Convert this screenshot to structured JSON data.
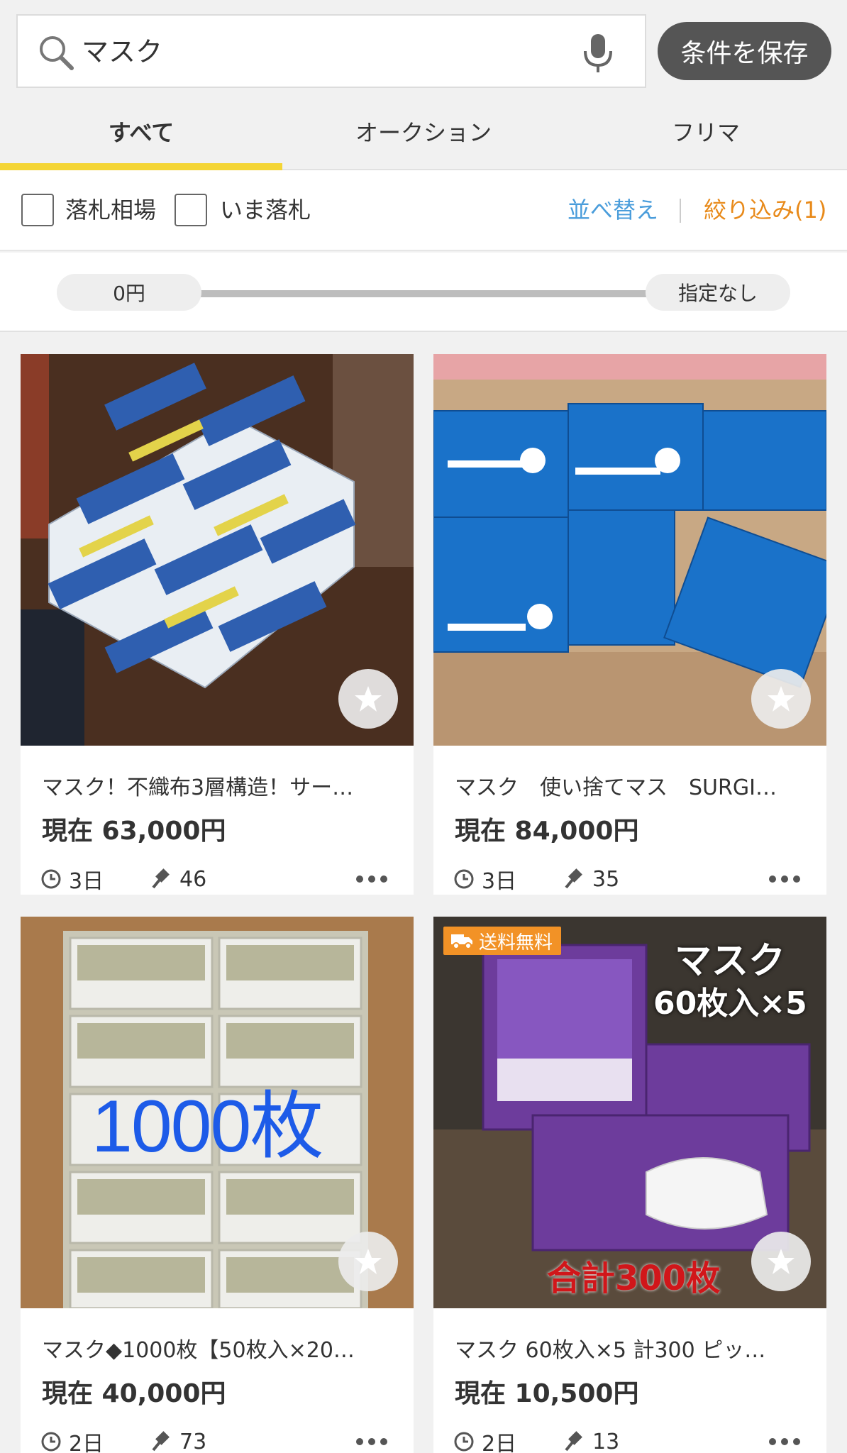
{
  "search": {
    "query": "マスク",
    "save_label": "条件を保存"
  },
  "tabs": [
    {
      "label": "すべて",
      "active": true
    },
    {
      "label": "オークション",
      "active": false
    },
    {
      "label": "フリマ",
      "active": false
    }
  ],
  "filters": {
    "checkbox1": "落札相場",
    "checkbox2": "いま落札",
    "sort": "並べ替え",
    "refine": "絞り込み(1)"
  },
  "price_range": {
    "min": "0円",
    "max": "指定なし"
  },
  "listings": [
    {
      "title": "マスク！不織布3層構造！サー…",
      "price": "現在 63,000円",
      "time_left": "3日",
      "bids": "46"
    },
    {
      "title": "マスク　使い捨てマス　SURGI…",
      "price": "現在 84,000円",
      "time_left": "3日",
      "bids": "35"
    },
    {
      "title": "マスク◆1000枚【50枚入×20…",
      "price": "現在 40,000円",
      "time_left": "2日",
      "bids": "73",
      "image_text": "1000枚"
    },
    {
      "title": "マスク 60枚入×5 計300 ピッ…",
      "price": "現在 10,500円",
      "time_left": "2日",
      "bids": "13",
      "badge": "送料無料",
      "image_text_title": "マスク",
      "image_text_sub": "60枚入×5",
      "image_text_red": "合計300枚"
    }
  ],
  "colors": {
    "tab_indicator": "#f4d535",
    "sort_link": "#4a9ddb",
    "refine_link": "#e88a1a",
    "shipping_badge": "#f29226"
  }
}
